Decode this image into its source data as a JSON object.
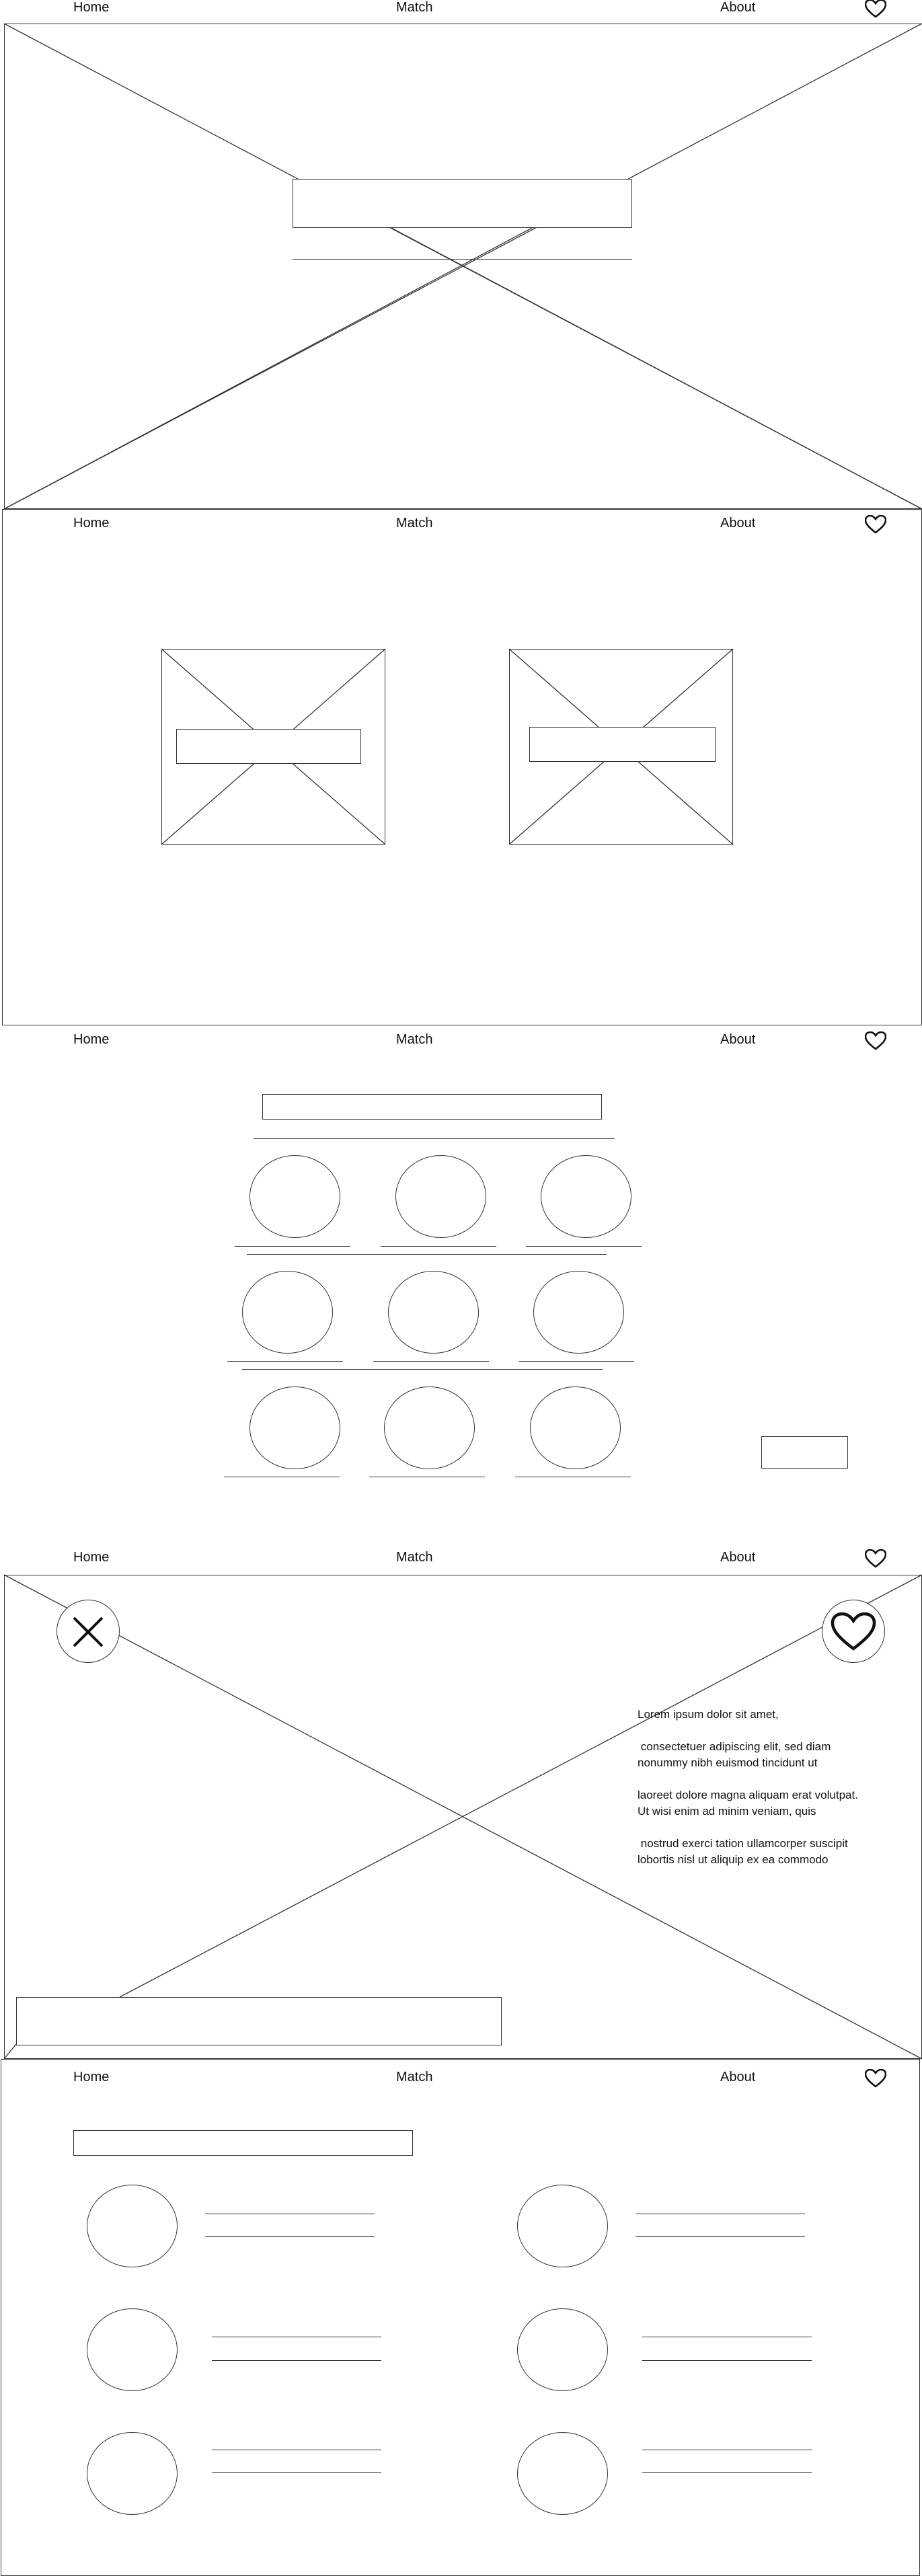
{
  "nav": {
    "home_label": "Home",
    "match_label": "Match",
    "about_label": "About",
    "heart_icon": "heart-icon"
  },
  "profile": {
    "reject_icon": "close-icon",
    "like_icon": "heart-icon",
    "description": [
      "Lorem ipsum dolor sit amet,",
      " consectetuer adipiscing elit, sed diam nonummy nibh euismod tincidunt ut",
      "laoreet dolore magna aliquam erat volutpat. Ut wisi enim ad minim veniam, quis",
      " nostrud exerci tation ullamcorper suscipit lobortis nisl ut aliquip ex ea commodo"
    ]
  }
}
